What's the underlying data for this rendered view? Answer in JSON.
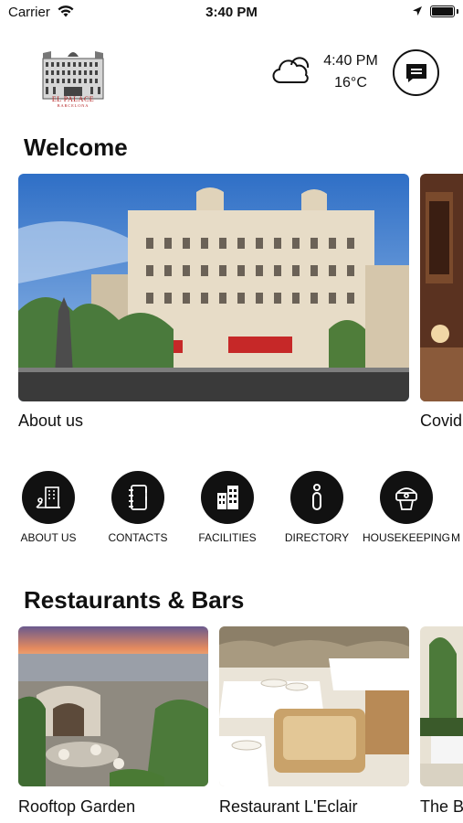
{
  "status_bar": {
    "carrier": "Carrier",
    "time": "3:40 PM"
  },
  "header": {
    "logo_text": "EL PALACE",
    "logo_subtext": "BARCELONA",
    "weather_time": "4:40 PM",
    "weather_temp": "16°C",
    "weather_icon": "cloud-icon",
    "chat_icon": "chat-icon"
  },
  "welcome": {
    "title": "Welcome",
    "cards": [
      {
        "label": "About us"
      },
      {
        "label": "Covid"
      }
    ]
  },
  "quick_menu": {
    "items": [
      {
        "label": "ABOUT US",
        "icon": "building-info-icon"
      },
      {
        "label": "CONTACTS",
        "icon": "address-book-icon"
      },
      {
        "label": "FACILITIES",
        "icon": "buildings-icon"
      },
      {
        "label": "DIRECTORY",
        "icon": "info-icon"
      },
      {
        "label": "HOUSEKEEPING",
        "icon": "housekeeping-icon"
      },
      {
        "label": "M"
      }
    ]
  },
  "restaurants": {
    "title": "Restaurants & Bars",
    "cards": [
      {
        "label": "Rooftop Garden"
      },
      {
        "label": "Restaurant L'Eclair"
      },
      {
        "label": "The B"
      }
    ]
  },
  "colors": {
    "icon_background": "#111111",
    "logo_red": "#b32020"
  }
}
